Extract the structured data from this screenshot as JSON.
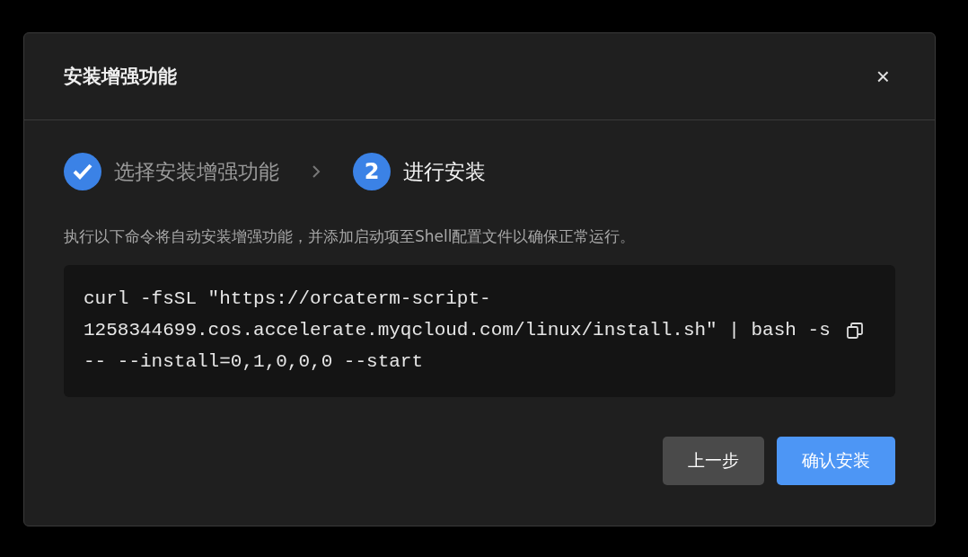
{
  "dialog": {
    "title": "安装增强功能",
    "close": "×"
  },
  "steps": [
    {
      "label": "选择安装增强功能",
      "completed": true,
      "selected": false
    },
    {
      "label": "进行安装",
      "completed": false,
      "selected": true,
      "number": "2"
    }
  ],
  "description": "执行以下命令将自动安装增强功能，并添加启动项至Shell配置文件以确保正常运行。",
  "command": "curl -fsSL \"https://orcaterm-script-1258344699.cos.accelerate.myqcloud.com/linux/install.sh\" | bash -s -- --install=0,1,0,0,0 --start",
  "buttons": [
    {
      "label": "上一步",
      "kind": "secondary"
    },
    {
      "label": "确认安装",
      "kind": "primary"
    }
  ]
}
